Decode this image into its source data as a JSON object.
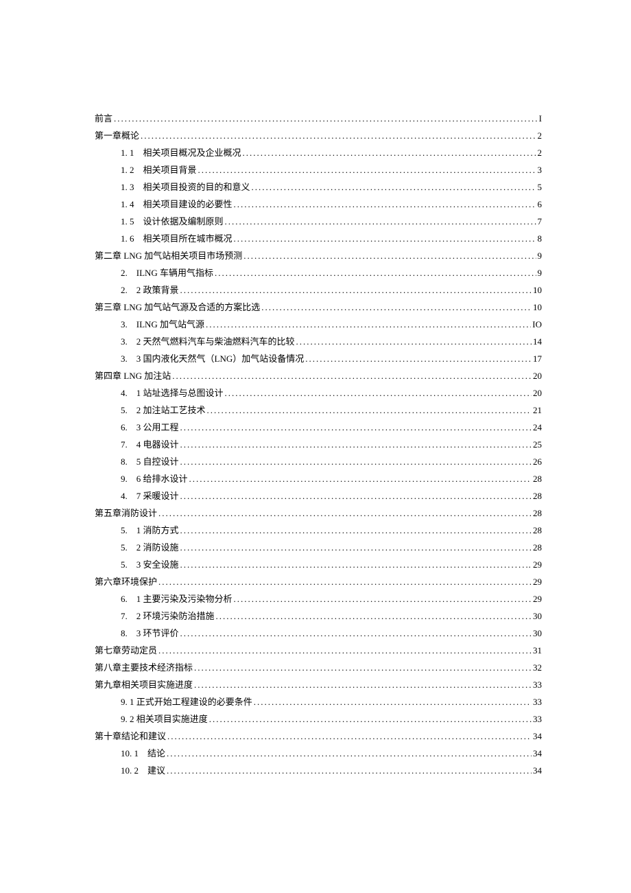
{
  "toc": {
    "entries": [
      {
        "level": 0,
        "label": "前言",
        "page": "I"
      },
      {
        "level": 0,
        "label": "第一章概论",
        "page": "2"
      },
      {
        "level": 1,
        "label": "1. 1　相关项目概况及企业概况 ",
        "page": "2"
      },
      {
        "level": 1,
        "label": "1. 2　相关项目背景 ",
        "page": "3"
      },
      {
        "level": 1,
        "label": "1. 3　相关项目投资的目的和意义 ",
        "page": "5"
      },
      {
        "level": 1,
        "label": "1. 4　相关项目建设的必要性 ",
        "page": "6"
      },
      {
        "level": 1,
        "label": "1. 5　设计依据及编制原则 ",
        "page": "7"
      },
      {
        "level": 1,
        "label": "1. 6　相关项目所在城市概况 ",
        "page": "8"
      },
      {
        "level": 0,
        "label": "第二章 LNG 加气站相关项目市场预测 ",
        "page": "9"
      },
      {
        "level": 1,
        "label": "2.　ILNG 车辆用气指标 ",
        "page": "9"
      },
      {
        "level": 1,
        "label": "2.　2 政策背景 ",
        "page": "10"
      },
      {
        "level": 0,
        "label": "第三章 LNG 加气站气源及合适的方案比选 ",
        "page": "10"
      },
      {
        "level": 1,
        "label": "3.　ILNG 加气站气源 ",
        "page": "IO"
      },
      {
        "level": 1,
        "label": "3.　2 天然气燃料汽车与柴油燃料汽车的比较  ",
        "page": "14"
      },
      {
        "level": 1,
        "label": "3.　3 国内液化天然气（LNG）加气站设备情况",
        "page": "17"
      },
      {
        "level": 0,
        "label": "第四章 LNG 加注站 ",
        "page": "20"
      },
      {
        "level": 1,
        "label": "4.　1 站址选择与总图设计 ",
        "page": "20"
      },
      {
        "level": 1,
        "label": "5.　2 加注站工艺技术 ",
        "page": "21"
      },
      {
        "level": 1,
        "label": "6.　3 公用工程 ",
        "page": "24"
      },
      {
        "level": 1,
        "label": "7.　4 电器设计 ",
        "page": "25"
      },
      {
        "level": 1,
        "label": "8.　5 自控设计 ",
        "page": "26"
      },
      {
        "level": 1,
        "label": "9.　6 给排水设计 ",
        "page": "28"
      },
      {
        "level": 1,
        "label": "4.　7 采暖设计 ",
        "page": "28"
      },
      {
        "level": 0,
        "label": "第五章消防设计 ",
        "page": "28"
      },
      {
        "level": 1,
        "label": "5.　1 消防方式 ",
        "page": "28"
      },
      {
        "level": 1,
        "label": "5.　2 消防设施 ",
        "page": "28"
      },
      {
        "level": 1,
        "label": "5.　3 安全设施 ",
        "page": ". 29"
      },
      {
        "level": 0,
        "label": "第六章环境保护 ",
        "page": "29"
      },
      {
        "level": 1,
        "label": "6.　1 主要污染及污染物分析 ",
        "page": "29"
      },
      {
        "level": 1,
        "label": "7.　2 环境污染防治措施 ",
        "page": "30"
      },
      {
        "level": 1,
        "label": "8.　3 环节评价 ",
        "page": "30"
      },
      {
        "level": 0,
        "label": "第七章劳动定员 ",
        "page": "31"
      },
      {
        "level": 0,
        "label": "第八章主要技术经济指标 ",
        "page": "32"
      },
      {
        "level": 0,
        "label": "第九章相关项目实施进度 ",
        "page": "33"
      },
      {
        "level": 1,
        "label": "9. 1 正式开始工程建设的必要条件",
        "page": "33"
      },
      {
        "level": 1,
        "label": "9. 2 相关项目实施进度",
        "page": "33"
      },
      {
        "level": 0,
        "label": "第十章结论和建议 ",
        "page": "34"
      },
      {
        "level": 1,
        "label": "10. 1　结论 ",
        "page": "34"
      },
      {
        "level": 1,
        "label": "10. 2　建议 ",
        "page": "34"
      }
    ]
  }
}
